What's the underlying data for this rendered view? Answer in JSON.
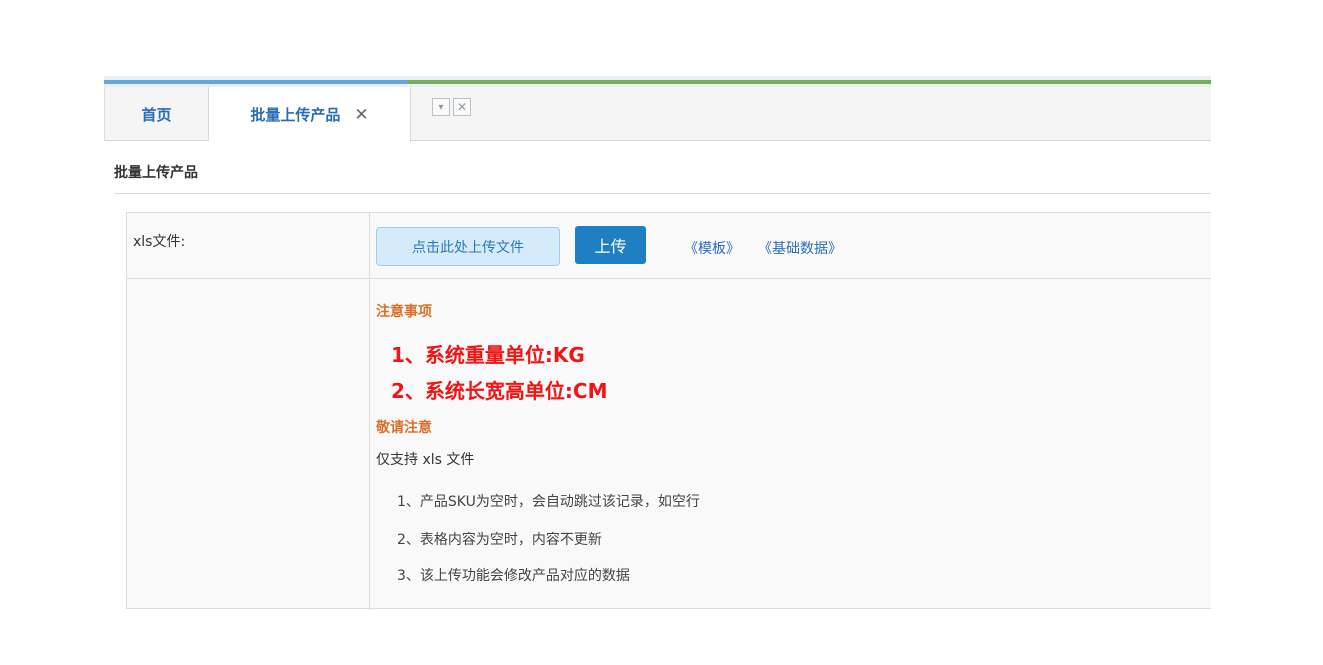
{
  "tabs": {
    "home": "首页",
    "active": "批量上传产品",
    "close_glyph": "✕"
  },
  "tools": {
    "dropdown_glyph": "▾",
    "close_glyph": "✕"
  },
  "page": {
    "heading": "批量上传产品"
  },
  "upload": {
    "label": "xls文件:",
    "choose_button": "点击此处上传文件",
    "submit_button": "上传",
    "link_template": "《模板》",
    "link_base_data": "《基础数据》"
  },
  "notes": {
    "title": "注意事项",
    "warning_1": "1、系统重量单位:KG",
    "warning_2": "2、系统长宽高单位:CM",
    "title_2": "敬请注意",
    "support": "仅支持 xls 文件",
    "rules": [
      "1、产品SKU为空时，会自动跳过该记录，如空行",
      "2、表格内容为空时，内容不更新",
      "3、该上传功能会修改产品对应的数据"
    ]
  },
  "colors": {
    "accent_blue": "#1e7fc3",
    "warning_red": "#f01414",
    "note_orange": "#d9702a"
  }
}
